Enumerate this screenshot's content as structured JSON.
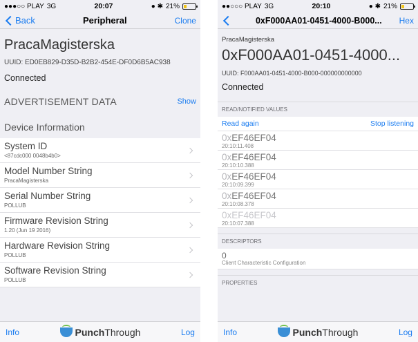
{
  "left": {
    "status": {
      "carrier": "●●●○○ PLAY",
      "network": "3G",
      "time": "20:07",
      "icons": "● ✱",
      "battery": "21%"
    },
    "nav": {
      "back": "Back",
      "title": "Peripheral",
      "action": "Clone"
    },
    "device_name": "PracaMagisterska",
    "uuid": "UUID: ED0EB829-D35D-B2B2-454E-DF0D6B5AC938",
    "connection": "Connected",
    "advertisement": {
      "label": "ADVERTISEMENT DATA",
      "action": "Show"
    },
    "section_title": "Device Information",
    "items": [
      {
        "title": "System ID",
        "subtitle": "<87cdc000 0048b4b0>"
      },
      {
        "title": "Model Number String",
        "subtitle": "PracaMagisterska"
      },
      {
        "title": "Serial Number String",
        "subtitle": "POLLUB"
      },
      {
        "title": "Firmware Revision String",
        "subtitle": "1.20 (Jun 19 2016)"
      },
      {
        "title": "Hardware Revision String",
        "subtitle": "POLLUB"
      },
      {
        "title": "Software Revision String",
        "subtitle": "POLLUB"
      }
    ],
    "tabbar": {
      "left": "Info",
      "brand_a": "Punch",
      "brand_b": "Through",
      "right": "Log"
    }
  },
  "right": {
    "status": {
      "carrier": "●●○○○ PLAY",
      "network": "3G",
      "time": "20:10",
      "icons": "● ✱",
      "battery": "21%"
    },
    "nav": {
      "title": "0xF000AA01-0451-4000-B000...",
      "action": "Hex"
    },
    "device_name": "PracaMagisterska",
    "characteristic": "0xF000AA01-0451-4000...",
    "uuid": "UUID: F000AA01-0451-4000-B000-000000000000",
    "connection": "Connected",
    "values_caption": "READ/NOTIFIED VALUES",
    "read_again": "Read again",
    "stop_listening": "Stop listening",
    "values": [
      {
        "prefix": "0x",
        "value": "EF46EF04",
        "time": "20:10:11.408"
      },
      {
        "prefix": "0x",
        "value": "EF46EF04",
        "time": "20:10:10.388"
      },
      {
        "prefix": "0x",
        "value": "EF46EF04",
        "time": "20:10:09.399"
      },
      {
        "prefix": "0x",
        "value": "EF46EF04",
        "time": "20:10:08.378"
      },
      {
        "prefix": "0x",
        "value": "EF46EF04",
        "time": "20:10:07.388"
      }
    ],
    "descriptors_caption": "DESCRIPTORS",
    "descriptor": {
      "value": "0",
      "name": "Client Characteristic Configuration"
    },
    "properties_caption": "PROPERTIES",
    "tabbar": {
      "left": "Info",
      "brand_a": "Punch",
      "brand_b": "Through",
      "right": "Log"
    }
  },
  "colors": {
    "accent": "#1a7cf0",
    "background": "#efeff4",
    "battery": "#f0c419"
  },
  "battery_level": 0.21
}
